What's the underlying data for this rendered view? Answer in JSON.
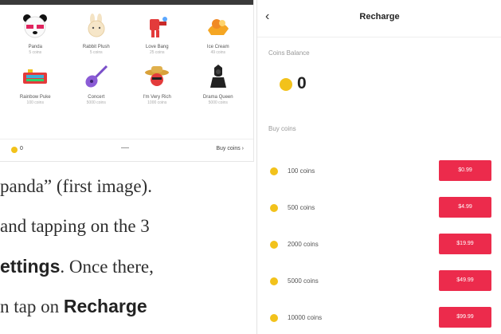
{
  "gifts": [
    {
      "name": "Panda",
      "price": "5 coins"
    },
    {
      "name": "Rabbit Plush",
      "price": "5 coins"
    },
    {
      "name": "Love Bang",
      "price": "25 coins"
    },
    {
      "name": "Ice Cream",
      "price": "49 coins"
    },
    {
      "name": "Rainbow Puke",
      "price": "100 coins"
    },
    {
      "name": "Concert",
      "price": "5000 coins"
    },
    {
      "name": "I'm Very Rich",
      "price": "1000 coins"
    },
    {
      "name": "Drama Queen",
      "price": "5000 coins"
    }
  ],
  "gift_footer": {
    "balance": "0",
    "dash": "—",
    "buy_label": "Buy coins ›"
  },
  "article": {
    "line1": "panda” (first image).",
    "line2": "and tapping on the 3",
    "line3_bold": "ettings",
    "line3_rest": ". Once there,",
    "line4_pre": "n tap on ",
    "line4_bold": "Recharge"
  },
  "recharge": {
    "back": "‹",
    "title": "Recharge",
    "balance_label": "Coins Balance",
    "balance": "0",
    "buy_label": "Buy coins",
    "options": [
      {
        "coins": "100 coins",
        "price": "$0.99"
      },
      {
        "coins": "500 coins",
        "price": "$4.99"
      },
      {
        "coins": "2000 coins",
        "price": "$19.99"
      },
      {
        "coins": "5000 coins",
        "price": "$49.99"
      },
      {
        "coins": "10000 coins",
        "price": "$99.99"
      }
    ]
  },
  "colors": {
    "accent": "#ec2b4c",
    "coin": "#f2c21b"
  },
  "icons": [
    "panda-icon",
    "rabbit-icon",
    "love-bang-icon",
    "ice-cream-icon",
    "rainbow-puke-icon",
    "guitar-icon",
    "rich-hat-icon",
    "drama-queen-icon",
    "coin-icon",
    "back-icon"
  ]
}
